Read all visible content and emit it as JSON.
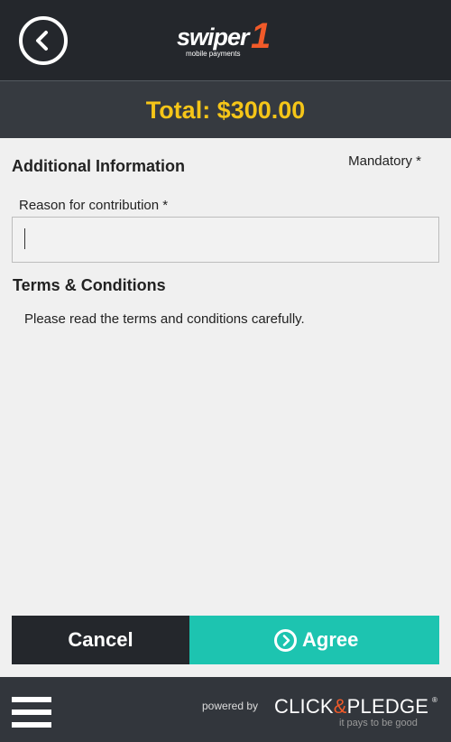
{
  "header": {
    "back_icon": "chevron-left-circle-icon",
    "logo": {
      "word": "swiper",
      "digit": "1",
      "sub": "mobile payments"
    }
  },
  "total": {
    "text": "Total: $300.00"
  },
  "form": {
    "section_title": "Additional Information",
    "mandatory": "Mandatory *",
    "reason_label": "Reason for contribution *",
    "reason_value": "",
    "terms_title": "Terms & Conditions",
    "terms_text": "Please read the terms and conditions carefully."
  },
  "actions": {
    "cancel_label": "Cancel",
    "agree_label": "Agree",
    "agree_icon": "chevron-right-circle-icon"
  },
  "footer": {
    "menu_icon": "hamburger-menu-icon",
    "powered_by": "powered by",
    "brand_part1": "CLICK",
    "brand_amp": "&",
    "brand_part2": "PLEDGE",
    "brand_reg": "®",
    "tagline": "it pays to be good"
  },
  "colors": {
    "header_bg": "#24272c",
    "total_bar_bg": "#363a40",
    "total_text": "#f5c518",
    "agree_bg": "#1dc4b0",
    "cancel_bg": "#24272c",
    "footer_bg": "#32363c",
    "brand_accent": "#f15a29"
  }
}
